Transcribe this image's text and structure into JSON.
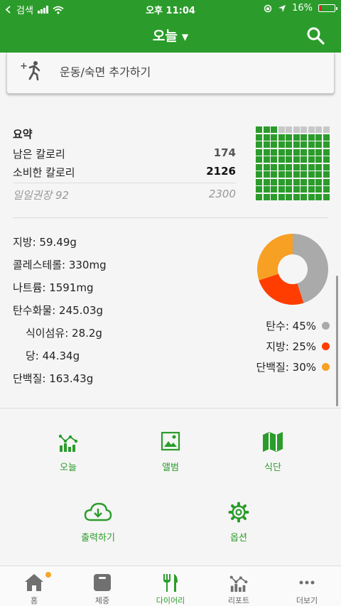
{
  "status_bar": {
    "carrier": "검색",
    "time": "오후 11:04",
    "battery_percent": "16%",
    "battery_level": 0.16
  },
  "header": {
    "title": "오늘"
  },
  "add_card": {
    "label": "운동/숙면 추가하기"
  },
  "summary": {
    "title": "요약",
    "remaining_label": "남은 칼로리",
    "remaining_value": "174",
    "consumed_label": "소비한 칼로리",
    "consumed_value": "2126",
    "recommended_label": "일일권장 92",
    "recommended_value": "2300",
    "grid_total": 100,
    "grid_filled": 93,
    "grid_colors": {
      "filled": "#2b9c2b",
      "empty": "#c8c8c8"
    }
  },
  "nutrition": [
    {
      "label": "지방: 59.49g",
      "sub": false
    },
    {
      "label": "콜레스테롤: 330mg",
      "sub": false
    },
    {
      "label": "나트륨: 1591mg",
      "sub": false
    },
    {
      "label": "탄수화물: 245.03g",
      "sub": false
    },
    {
      "label": "식이섬유: 28.2g",
      "sub": true
    },
    {
      "label": "당: 44.34g",
      "sub": true
    },
    {
      "label": "단백질: 163.43g",
      "sub": false
    }
  ],
  "macros": [
    {
      "label": "탄수: 45%",
      "percent": 45,
      "color": "#aaaaaa"
    },
    {
      "label": "지방: 25%",
      "percent": 25,
      "color": "#ff3d00"
    },
    {
      "label": "단백질: 30%",
      "percent": 30,
      "color": "#f7a024"
    }
  ],
  "shortcuts": {
    "today": "오늘",
    "album": "앨범",
    "meals": "식단",
    "export": "출력하기",
    "options": "옵션"
  },
  "tabs": {
    "home": "홈",
    "weight": "체중",
    "diary": "다이어리",
    "report": "리포트",
    "more": "더보기"
  },
  "colors": {
    "brand": "#2b9c2b",
    "badge": "#f5a623"
  }
}
